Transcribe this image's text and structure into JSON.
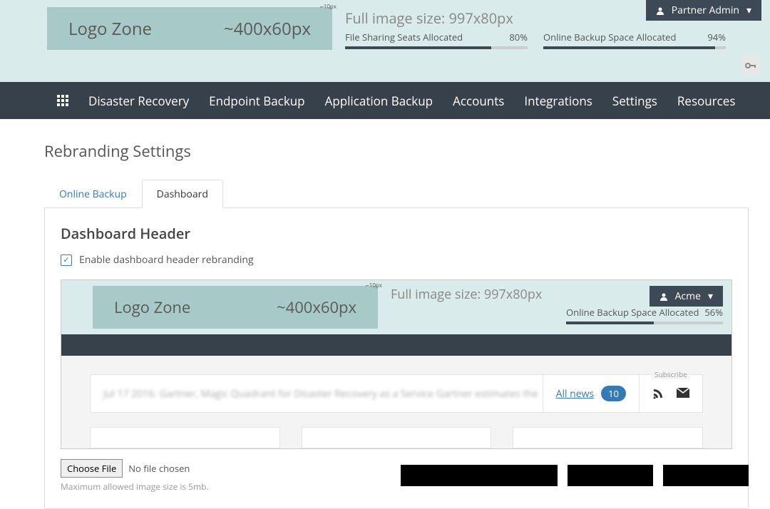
{
  "header": {
    "logo_zone_label": "Logo Zone",
    "logo_zone_size": "~400x60px",
    "full_size_label": "Full image size: 997x80px",
    "stat1_label": "File Sharing Seats Allocated",
    "stat1_value": "80%",
    "stat1_fill": 80,
    "stat2_label": "Online Backup Space Allocated",
    "stat2_value": "94%",
    "stat2_fill": 94,
    "user_label": "Partner Admin"
  },
  "nav": {
    "items": [
      "Disaster Recovery",
      "Endpoint Backup",
      "Application Backup",
      "Accounts",
      "Integrations",
      "Settings",
      "Resources"
    ]
  },
  "page": {
    "title": "Rebranding Settings",
    "tabs": {
      "online_backup": "Online Backup",
      "dashboard": "Dashboard"
    },
    "section_title": "Dashboard Header",
    "checkbox_label": "Enable dashboard header rebranding"
  },
  "preview": {
    "logo_zone_label": "Logo Zone",
    "logo_zone_size": "~400x60px",
    "full_size_label": "Full image size: 997x80px",
    "stat_label": "Online Backup Space Allocated",
    "stat_value": "56%",
    "stat_fill": 56,
    "user_label": "Acme",
    "news_blur": "Jul 17 2016:  Gartner, Magic Quadrant for Disaster Recovery as a Service  Gartner estimates the",
    "all_news_label": "All news",
    "news_count": "10",
    "subscribe_label": "Subscribe"
  },
  "file": {
    "button": "Choose File",
    "status": "No file chosen",
    "hint": "Maximum allowed image size is 5mb."
  }
}
